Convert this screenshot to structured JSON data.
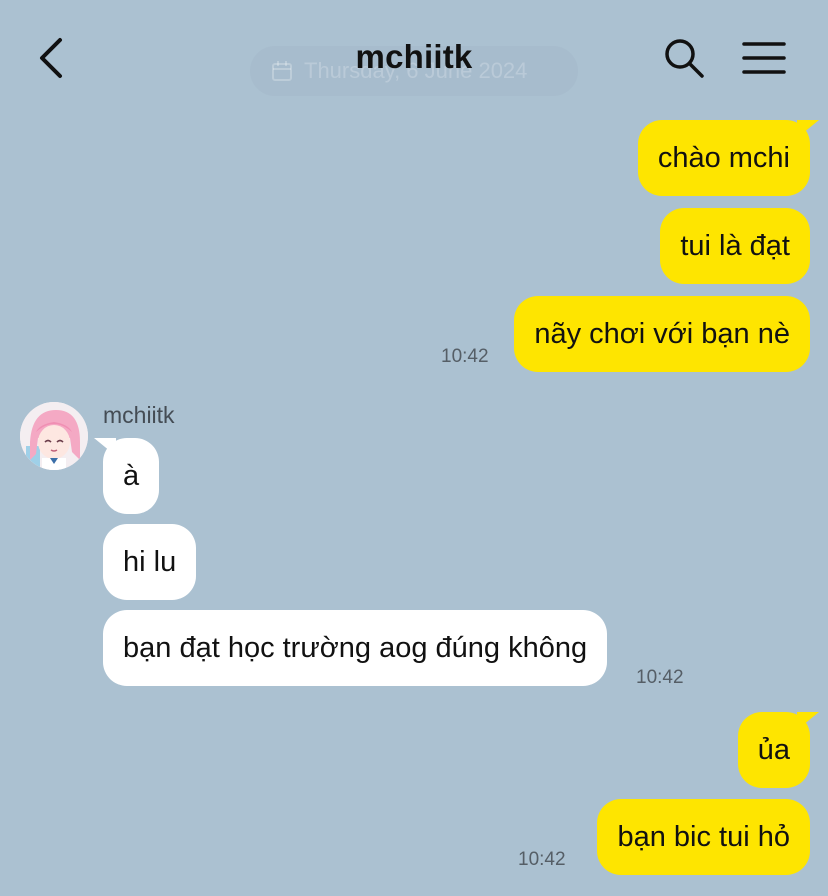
{
  "header": {
    "title": "mchiitk",
    "date_divider": "Thursday, 6 June 2024"
  },
  "chat": {
    "sender_name": "mchiitk",
    "messages": [
      {
        "from": "me",
        "text": "chào mchi"
      },
      {
        "from": "me",
        "text": "tui là đạt"
      },
      {
        "from": "me",
        "text": "nãy chơi với bạn nè",
        "time": "10:42"
      },
      {
        "from": "them",
        "text": "à"
      },
      {
        "from": "them",
        "text": "hi lu"
      },
      {
        "from": "them",
        "text": "bạn đạt học trường aog đúng không",
        "time": "10:42"
      },
      {
        "from": "me",
        "text": "ủa"
      },
      {
        "from": "me",
        "text": "bạn bic tui hỏ",
        "time": "10:42"
      }
    ]
  },
  "colors": {
    "background": "#abc1d1",
    "sent_bubble": "#fee500",
    "received_bubble": "#ffffff"
  },
  "icons": [
    "back-arrow-icon",
    "search-icon",
    "menu-icon",
    "calendar-icon",
    "avatar-image"
  ]
}
